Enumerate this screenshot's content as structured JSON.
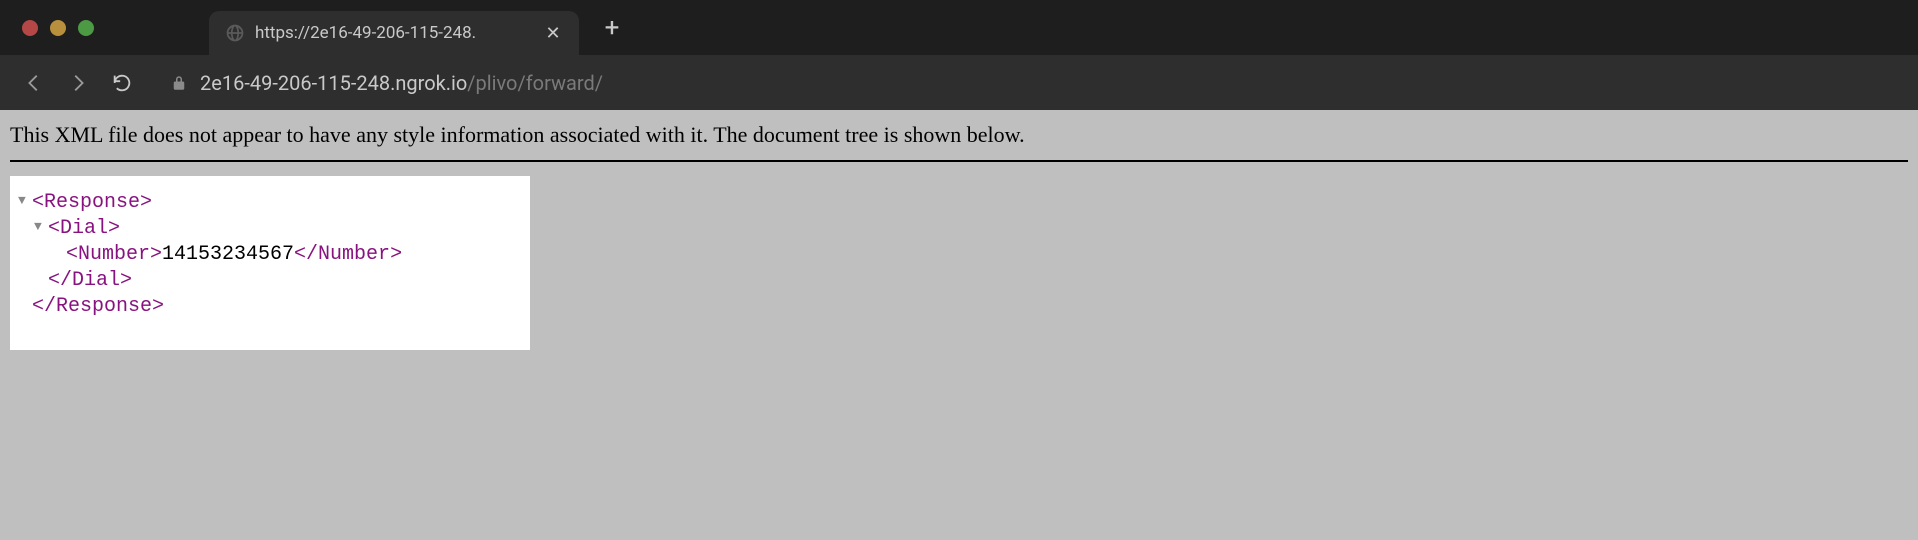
{
  "tab": {
    "title": "https://2e16-49-206-115-248."
  },
  "url": {
    "host": "2e16-49-206-115-248.ngrok.io",
    "path": "/plivo/forward/"
  },
  "notice": "This XML file does not appear to have any style information associated with it. The document tree is shown below.",
  "xml": {
    "response_open": "<Response>",
    "dial_open": "<Dial>",
    "number_open": "<Number>",
    "number_value": "14153234567",
    "number_close": "</Number>",
    "dial_close": "</Dial>",
    "response_close": "</Response>"
  },
  "glyphs": {
    "toggle": "▼",
    "close": "✕",
    "plus": "+"
  }
}
